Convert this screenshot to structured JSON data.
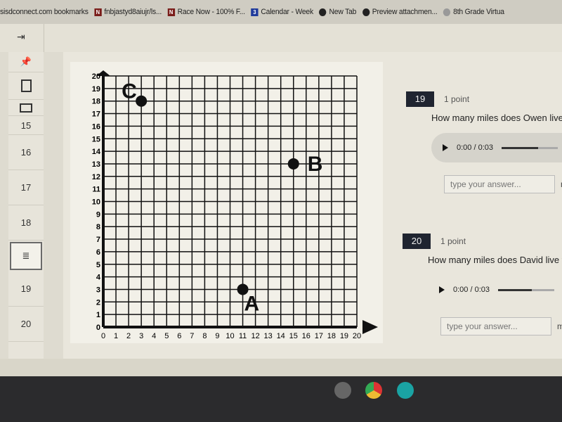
{
  "bookmarks": [
    {
      "label": "sisdconnect.com bookmarks",
      "icon": "none"
    },
    {
      "label": "fnbjastyd8aiujr/ls...",
      "icon": "n-logo-icon"
    },
    {
      "label": "Race Now - 100% F...",
      "icon": "n-logo-icon"
    },
    {
      "label": "Calendar - Week",
      "icon": "calendar-icon",
      "badge": "3"
    },
    {
      "label": "New Tab",
      "icon": "globe-icon"
    },
    {
      "label": "Preview attachmen...",
      "icon": "globe-icon"
    },
    {
      "label": "8th Grade Virtua",
      "icon": "globe-icon"
    }
  ],
  "sidebar": {
    "items": [
      "15",
      "16",
      "17",
      "18",
      "19",
      "20"
    ]
  },
  "chart_data": {
    "type": "scatter",
    "xlim": [
      0,
      20
    ],
    "ylim": [
      0,
      20
    ],
    "grid": true,
    "xticks": [
      "0",
      "1",
      "2",
      "3",
      "4",
      "5",
      "6",
      "7",
      "8",
      "9",
      "10",
      "11",
      "12",
      "13",
      "14",
      "15",
      "16",
      "17",
      "18",
      "19",
      "20"
    ],
    "yticks": [
      "0",
      "1",
      "2",
      "3",
      "4",
      "5",
      "6",
      "7",
      "8",
      "9",
      "10",
      "11",
      "12",
      "13",
      "14",
      "15",
      "16",
      "17",
      "18",
      "19",
      "20"
    ],
    "points": [
      {
        "label": "C",
        "x": 3,
        "y": 18
      },
      {
        "label": "B",
        "x": 15,
        "y": 13
      },
      {
        "label": "A",
        "x": 11,
        "y": 3
      }
    ]
  },
  "questions": [
    {
      "number": "19",
      "points": "1 point",
      "text": "How many miles does Owen live fr",
      "time": "0:00 / 0:03",
      "progress": 0.65,
      "placeholder": "type your answer...",
      "unit": "m"
    },
    {
      "number": "20",
      "points": "1 point",
      "text": "How many miles does David live fro",
      "time": "0:00 / 0:03",
      "progress": 0.6,
      "placeholder": "type your answer...",
      "unit": "mil"
    }
  ]
}
